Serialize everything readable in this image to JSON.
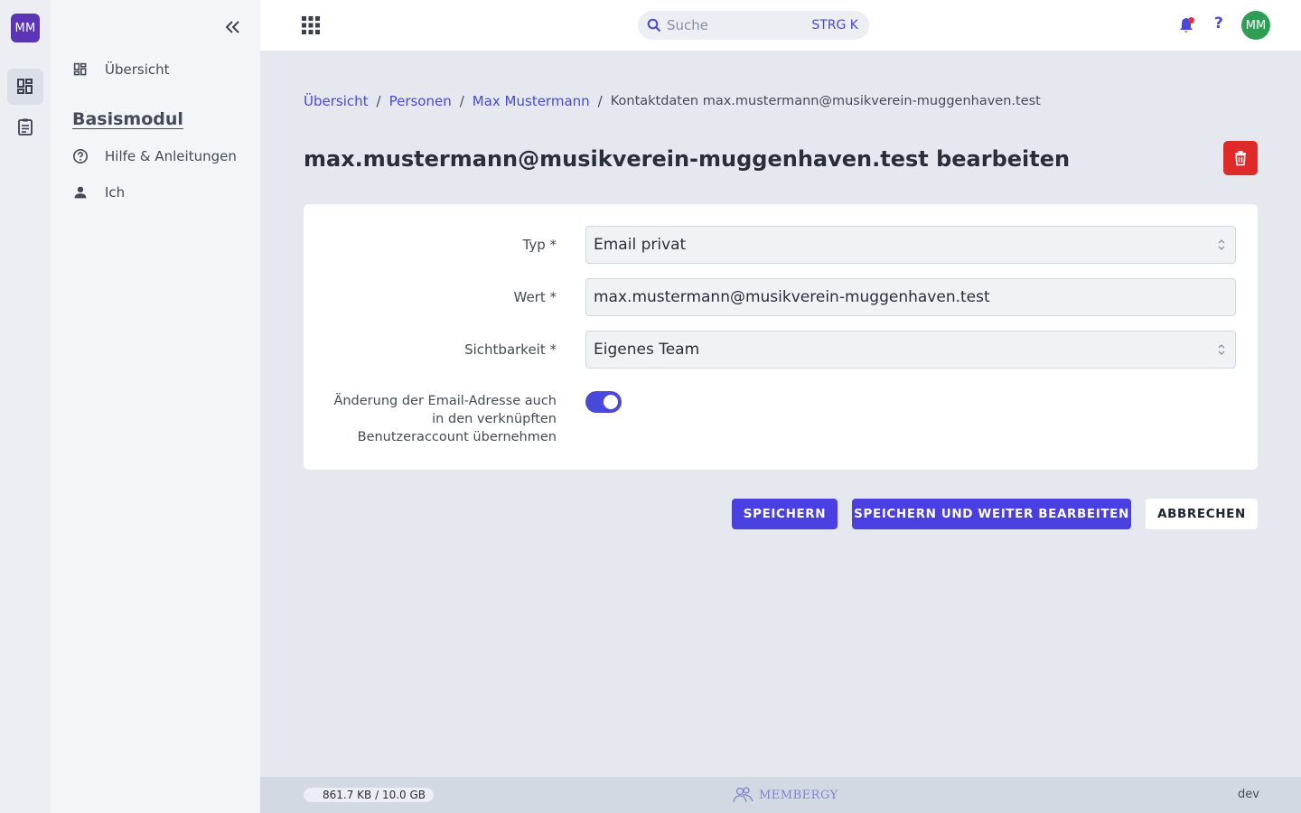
{
  "rail": {
    "logo": "MM",
    "items": [
      {
        "name": "dashboard",
        "active": true
      },
      {
        "name": "clipboard",
        "active": false
      }
    ]
  },
  "sidebar": {
    "overview_label": "Übersicht",
    "section_title": "Basismodul",
    "items": [
      {
        "label": "Hilfe & Anleitungen",
        "icon": "help-circle-icon"
      },
      {
        "label": "Ich",
        "icon": "person-icon"
      }
    ]
  },
  "topbar": {
    "search_placeholder": "Suche",
    "search_shortcut": "STRG K",
    "help_label": "?",
    "avatar_initials": "MM",
    "notification_color": "#e2333a",
    "avatar_color": "#2e9e55"
  },
  "breadcrumb": {
    "items": [
      "Übersicht",
      "Personen",
      "Max Mustermann"
    ],
    "current": "Kontaktdaten max.mustermann@musikverein-muggenhaven.test"
  },
  "page": {
    "title": "max.mustermann@musikverein-muggenhaven.test bearbeiten"
  },
  "form": {
    "type_label": "Typ *",
    "type_value": "Email privat",
    "value_label": "Wert *",
    "value_value": "max.mustermann@musikverein-muggenhaven.test",
    "visibility_label": "Sichtbarkeit *",
    "visibility_value": "Eigenes Team",
    "sync_label_lines": [
      "Änderung der Email-Adresse auch",
      "in den verknüpften",
      "Benutzeraccount übernehmen"
    ],
    "sync_enabled": true
  },
  "actions": {
    "save": "SPEICHERN",
    "save_continue": "SPEICHERN UND WEITER BEARBEITEN",
    "cancel": "ABBRECHEN"
  },
  "footer": {
    "storage": "861.7 KB / 10.0 GB",
    "brand": "MEMBERGY",
    "env": "dev"
  },
  "colors": {
    "accent": "#4a48d8",
    "danger": "#e02a2a",
    "logo": "#5b35b5"
  }
}
